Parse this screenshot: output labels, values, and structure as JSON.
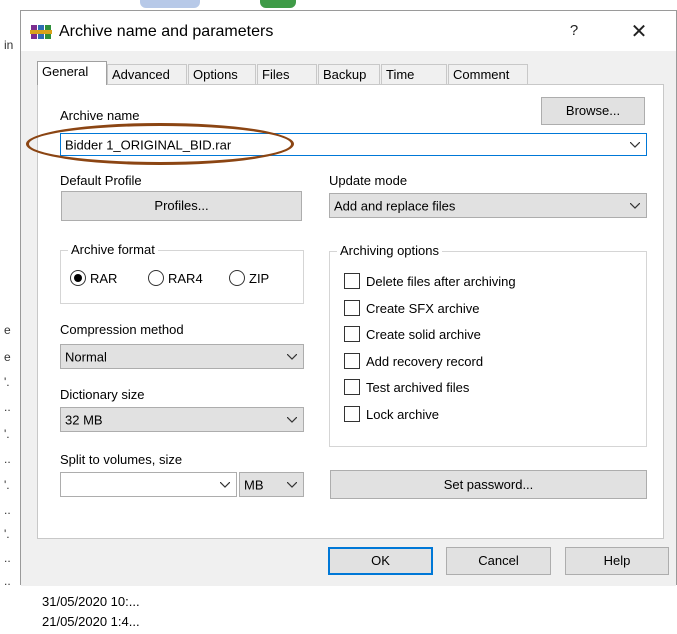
{
  "window": {
    "title": "Archive name and parameters",
    "help_label": "?",
    "close_label": "✕",
    "app_icon": "winrar-icon"
  },
  "tabs": [
    "General",
    "Advanced",
    "Options",
    "Files",
    "Backup",
    "Time",
    "Comment"
  ],
  "active_tab": "General",
  "archive_name": {
    "label": "Archive name",
    "browse_label": "Browse...",
    "value": "Bidder 1_ORIGINAL_BID.rar"
  },
  "default_profile": {
    "label": "Default Profile",
    "button_label": "Profiles..."
  },
  "update_mode": {
    "label": "Update mode",
    "value": "Add and replace files"
  },
  "archive_format": {
    "label": "Archive format",
    "options": [
      "RAR",
      "RAR4",
      "ZIP"
    ],
    "selected": "RAR"
  },
  "archiving_options": {
    "label": "Archiving options",
    "items": [
      {
        "label": "Delete files after archiving",
        "checked": false
      },
      {
        "label": "Create SFX archive",
        "checked": false
      },
      {
        "label": "Create solid archive",
        "checked": false
      },
      {
        "label": "Add recovery record",
        "checked": false
      },
      {
        "label": "Test archived files",
        "checked": false
      },
      {
        "label": "Lock archive",
        "checked": false
      }
    ]
  },
  "compression_method": {
    "label": "Compression method",
    "value": "Normal"
  },
  "dictionary_size": {
    "label": "Dictionary size",
    "value": "32 MB"
  },
  "split_volumes": {
    "label": "Split to volumes, size",
    "value": "",
    "unit": "MB"
  },
  "set_password_label": "Set password...",
  "footer": {
    "ok_label": "OK",
    "cancel_label": "Cancel",
    "help_label": "Help"
  },
  "background": {
    "dates": [
      "31/05/2020 10:...",
      "21/05/2020 1:4..."
    ],
    "left_fragments": [
      "in",
      "e",
      "e",
      "'.",
      "..",
      "'.",
      "..",
      "'.",
      "..",
      "'.",
      "..",
      ".."
    ]
  },
  "colors": {
    "accent_border": "#0078d7",
    "highlight_ellipse": "#8b4513",
    "dialog_bg": "#f0f0f0",
    "button_bg": "#e1e1e1"
  }
}
